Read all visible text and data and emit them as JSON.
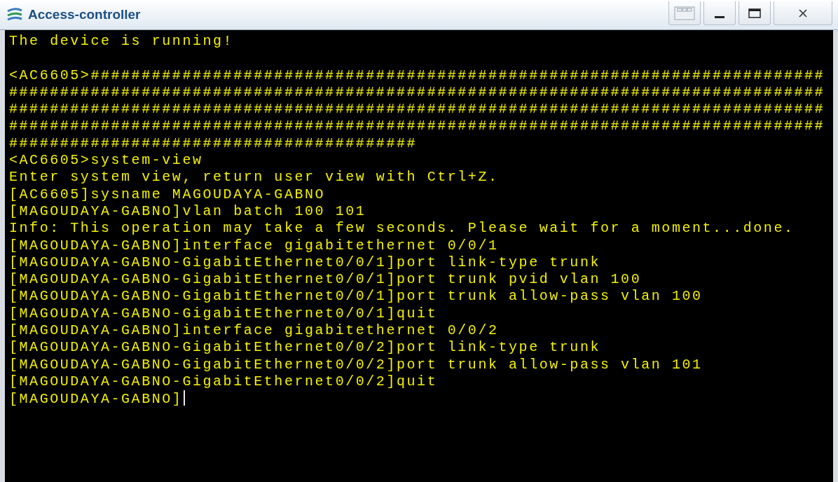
{
  "window": {
    "title": "Access-controller"
  },
  "terminal": {
    "cursor": true,
    "blocks": [
      [
        "The device is running!"
      ],
      [
        "<AC6605>########################################################################",
        "################################################################################",
        "################################################################################",
        "################################################################################",
        "########################################",
        "<AC6605>system-view",
        "Enter system view, return user view with Ctrl+Z.",
        "[AC6605]sysname MAGOUDAYA-GABNO",
        "[MAGOUDAYA-GABNO]vlan batch 100 101",
        "Info: This operation may take a few seconds. Please wait for a moment...done.",
        "[MAGOUDAYA-GABNO]interface gigabitethernet 0/0/1",
        "[MAGOUDAYA-GABNO-GigabitEthernet0/0/1]port link-type trunk",
        "[MAGOUDAYA-GABNO-GigabitEthernet0/0/1]port trunk pvid vlan 100",
        "[MAGOUDAYA-GABNO-GigabitEthernet0/0/1]port trunk allow-pass vlan 100",
        "[MAGOUDAYA-GABNO-GigabitEthernet0/0/1]quit",
        "[MAGOUDAYA-GABNO]interface gigabitethernet 0/0/2",
        "[MAGOUDAYA-GABNO-GigabitEthernet0/0/2]port link-type trunk",
        "[MAGOUDAYA-GABNO-GigabitEthernet0/0/2]port trunk allow-pass vlan 101",
        "[MAGOUDAYA-GABNO-GigabitEthernet0/0/2]quit",
        "[MAGOUDAYA-GABNO]"
      ]
    ]
  }
}
